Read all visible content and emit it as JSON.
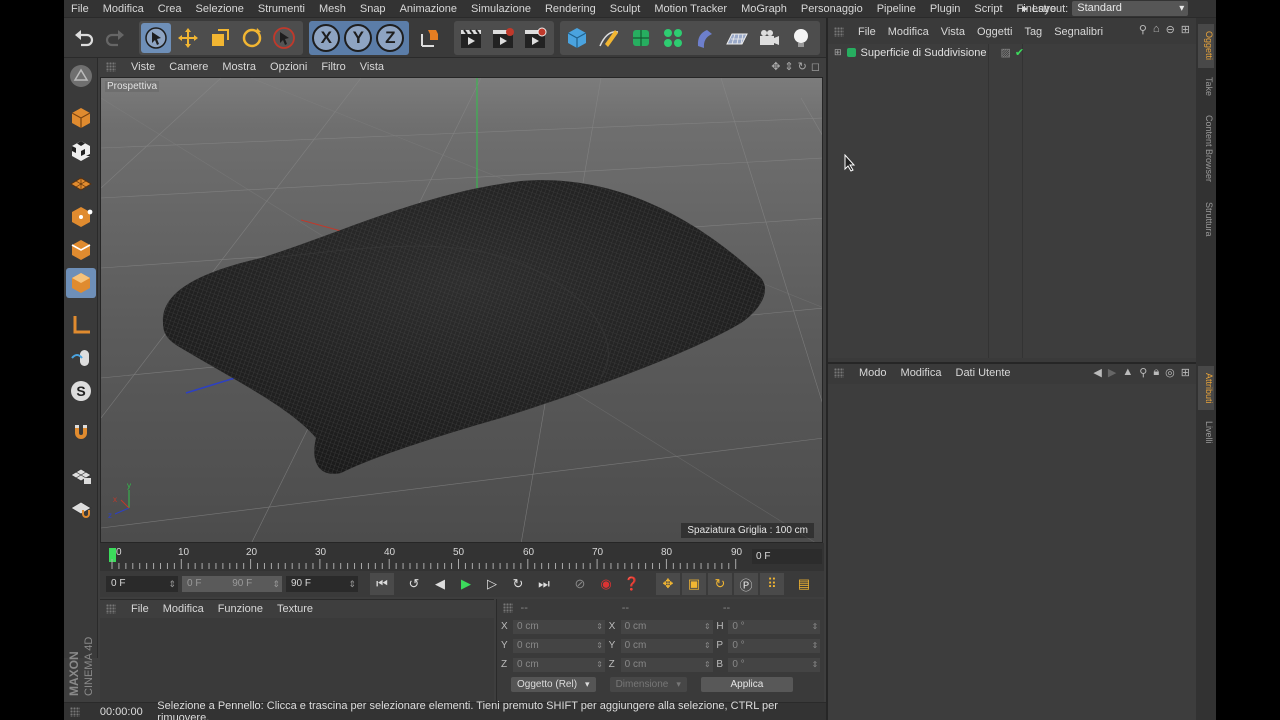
{
  "menubar": {
    "items": [
      "File",
      "Modifica",
      "Crea",
      "Selezione",
      "Strumenti",
      "Mesh",
      "Snap",
      "Animazione",
      "Simulazione",
      "Rendering",
      "Sculpt",
      "Motion Tracker",
      "MoGraph",
      "Personaggio",
      "Pipeline",
      "Plugin",
      "Script",
      "Finestre"
    ],
    "layout_label": "Layout:",
    "layout_value": "Standard"
  },
  "viewport": {
    "menu": [
      "Viste",
      "Camere",
      "Mostra",
      "Opzioni",
      "Filtro",
      "Vista"
    ],
    "label": "Prospettiva",
    "grid_spacing": "Spaziatura Griglia : 100 cm"
  },
  "timeline": {
    "ticks": [
      "0",
      "10",
      "20",
      "30",
      "40",
      "50",
      "60",
      "70",
      "80",
      "90"
    ],
    "current_frame": "0 F"
  },
  "transport": {
    "start": "0 F",
    "range_start": "0 F",
    "range_end": "90 F",
    "end": "90 F"
  },
  "material": {
    "menu": [
      "File",
      "Modifica",
      "Funzione",
      "Texture"
    ]
  },
  "coords": {
    "headers": [
      "--",
      "--",
      "--"
    ],
    "rows": [
      {
        "a1": "X",
        "v1": "0 cm",
        "a2": "X",
        "v2": "0 cm",
        "a3": "H",
        "v3": "0 °"
      },
      {
        "a1": "Y",
        "v1": "0 cm",
        "a2": "Y",
        "v2": "0 cm",
        "a3": "P",
        "v3": "0 °"
      },
      {
        "a1": "Z",
        "v1": "0 cm",
        "a2": "Z",
        "v2": "0 cm",
        "a3": "B",
        "v3": "0 °"
      }
    ],
    "mode": "Oggetto (Rel)",
    "size": "Dimensione",
    "apply": "Applica"
  },
  "status": {
    "time": "00:00:00",
    "message": "Selezione a Pennello: Clicca e trascina per selezionare elementi. Tieni premuto SHIFT per aggiungere alla selezione, CTRL per rimuovere."
  },
  "objects": {
    "menu": [
      "File",
      "Modifica",
      "Vista",
      "Oggetti",
      "Tag",
      "Segnalibri"
    ],
    "items": [
      {
        "name": "Superficie di Suddivisione"
      }
    ]
  },
  "attributes": {
    "menu": [
      "Modo",
      "Modifica",
      "Dati Utente"
    ]
  },
  "sidetabs": [
    "Oggetti",
    "Take",
    "Content Browser",
    "Struttura",
    "Attributi",
    "Livelli"
  ],
  "branding": {
    "maxon": "MAXON",
    "product": "CINEMA 4D"
  },
  "colors": {
    "accent": "#e8a33a",
    "active_tool": "#6e8fb8"
  }
}
